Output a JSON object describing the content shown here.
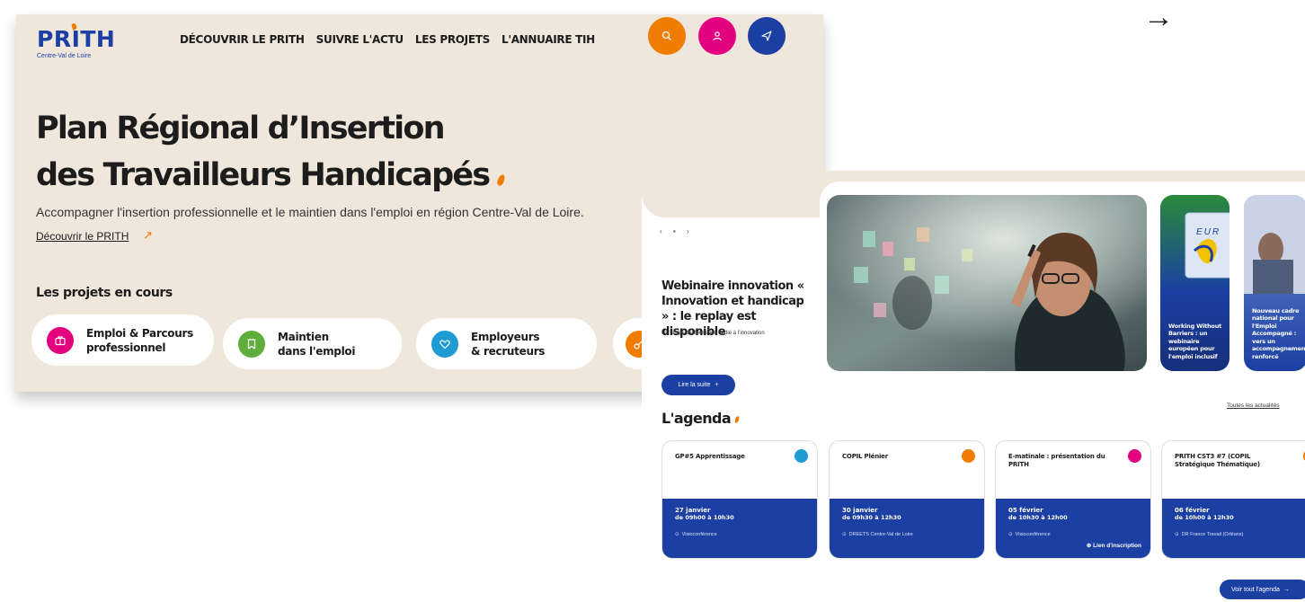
{
  "header": {
    "logo": {
      "word": "PRITH",
      "subtitle": "Centre-Val de Loire"
    },
    "nav": [
      "DÉCOUVRIR LE PRITH",
      "SUIVRE L'ACTU",
      "LES PROJETS",
      "L'ANNUAIRE TIH"
    ],
    "actions": [
      {
        "icon": "search-icon",
        "color": "#f07c00"
      },
      {
        "icon": "user-icon",
        "color": "#e3007e"
      },
      {
        "icon": "send-icon",
        "color": "#1b3fa3"
      }
    ]
  },
  "hero": {
    "title_line1": "Plan Régional d’Insertion",
    "title_line2": "des Travailleurs Handicapés",
    "subtitle": "Accompagner l'insertion professionnelle et le maintien dans l'emploi en région Centre-Val de Loire.",
    "link": "Découvrir le PRITH",
    "link_arrow": "↗"
  },
  "projects": {
    "title": "Les projets en cours",
    "items": [
      {
        "label_line1": "Emploi & Parcours",
        "label_line2": "professionnel",
        "icon": "briefcase-icon",
        "color": "#e3007e"
      },
      {
        "label_line1": "Maintien",
        "label_line2": "dans l'emploi",
        "icon": "bookmark-icon",
        "color": "#5fae3c"
      },
      {
        "label_line1": "Employeurs",
        "label_line2": "& recruteurs",
        "icon": "heart-icon",
        "color": "#1e9bd2"
      },
      {
        "label_line1": "",
        "label_line2": "",
        "icon": "key-icon",
        "color": "#f07c00"
      }
    ]
  },
  "news": {
    "slider_controls": "‹ ▪ ›",
    "title": "Webinaire innovation « Innovation et handicap » : le replay est disponible",
    "description": "Un temps d’information dédié à l’innovation",
    "read_more": "Lire la suite",
    "read_more_icon": "+",
    "cards": [
      {
        "label": "Working Without Barriers : un webinaire européen pour l'emploi inclusif",
        "banner": "EUR"
      },
      {
        "label": "Nouveau cadre national pour l'Emploi Accompagné : vers un accompagnement renforcé"
      }
    ],
    "all_news": "Toutes les actualités"
  },
  "agenda": {
    "title": "L'agenda",
    "events": [
      {
        "title": "GP#5 Apprentissage",
        "date": "27 janvier",
        "time": "de 09h00 à 10h30",
        "location": "Visioconférence",
        "badge_color": "#1e9bd2",
        "registration": ""
      },
      {
        "title": "COPIL Plénier",
        "date": "30 janvier",
        "time": "de 09h30 à 12h30",
        "location": "DREETS Centre-Val de Loire",
        "badge_color": "#f07c00",
        "registration": ""
      },
      {
        "title": "E-matinale : présentation du PRITH",
        "date": "05 février",
        "time": "de 10h30 à 12h00",
        "location": "Visioconférence",
        "badge_color": "#e3007e",
        "registration": "Lien d'inscription"
      },
      {
        "title": "PRITH CST3 #7 (COPIL Stratégique Thématique)",
        "date": "06 février",
        "time": "de 10h00 à 12h30",
        "location": "DR France Travail (Orléans)",
        "badge_color": "#f07c00",
        "registration": ""
      }
    ],
    "see_all": "Voir tout l'agenda",
    "see_all_arrow": "→"
  },
  "page_arrow": "→"
}
